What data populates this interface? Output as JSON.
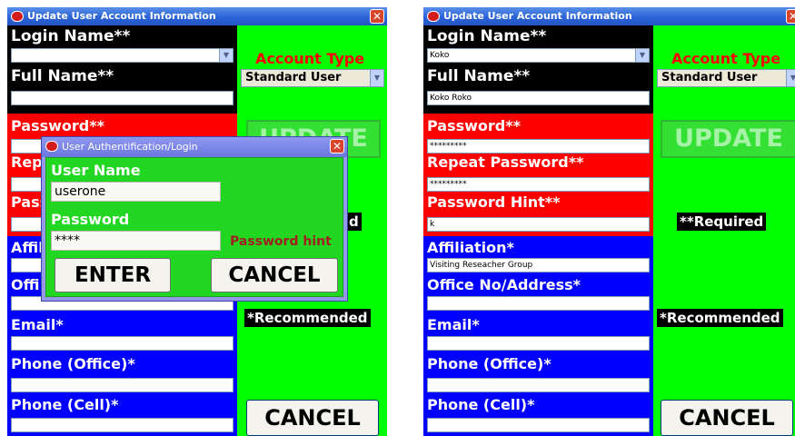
{
  "left": {
    "title": "Update User Account Information",
    "login_label": "Login Name**",
    "login_value": "",
    "fullname_label": "Full Name**",
    "fullname_value": "",
    "password_label": "Password**",
    "repeat_label_visible": "Rep",
    "hint_label_visible": "Pass",
    "affiliation_label_visible": "Affil",
    "office_label_visible": "Offi",
    "email_label": "Email*",
    "phone_office_label": "Phone (Office)*",
    "phone_cell_label": "Phone (Cell)*",
    "account_type_label": "Account Type",
    "account_type_value": "Standard User",
    "update_label": "UPDATE",
    "required_visible": "d",
    "recommended_label": "*Recommended",
    "cancel_label": "CANCEL"
  },
  "dialog": {
    "title": "User Authentification/Login",
    "username_label": "User Name",
    "username_value": "userone",
    "password_label": "Password",
    "password_value": "****",
    "hint_text": "Password hint",
    "enter_label": "ENTER",
    "cancel_label": "CANCEL"
  },
  "right": {
    "title": "Update User Account Information",
    "login_label": "Login Name**",
    "login_value": "Koko",
    "fullname_label": "Full Name**",
    "fullname_value": "Koko Roko",
    "password_label": "Password**",
    "password_value": "*********",
    "repeat_label": "Repeat Password**",
    "repeat_value": "*********",
    "hint_label": "Password Hint**",
    "hint_value": "k",
    "affiliation_label": "Affiliation*",
    "affiliation_value": "Visiting Reseacher Group",
    "office_label": "Office No/Address*",
    "office_value": "",
    "email_label": "Email*",
    "phone_office_label": "Phone (Office)*",
    "phone_cell_label": "Phone (Cell)*",
    "account_type_label": "Account Type",
    "account_type_value": "Standard User",
    "update_label": "UPDATE",
    "required_label": "**Required",
    "recommended_label": "*Recommended",
    "cancel_label": "CANCEL"
  },
  "icons": {
    "app": "app-logo-icon",
    "close": "close-icon",
    "dropdown": "chevron-down-icon"
  },
  "colors": {
    "required_panel": "#ff0000",
    "recommended_panel": "#0000ff",
    "side_panel": "#00ff00",
    "account_type_text": "#ff0000"
  }
}
